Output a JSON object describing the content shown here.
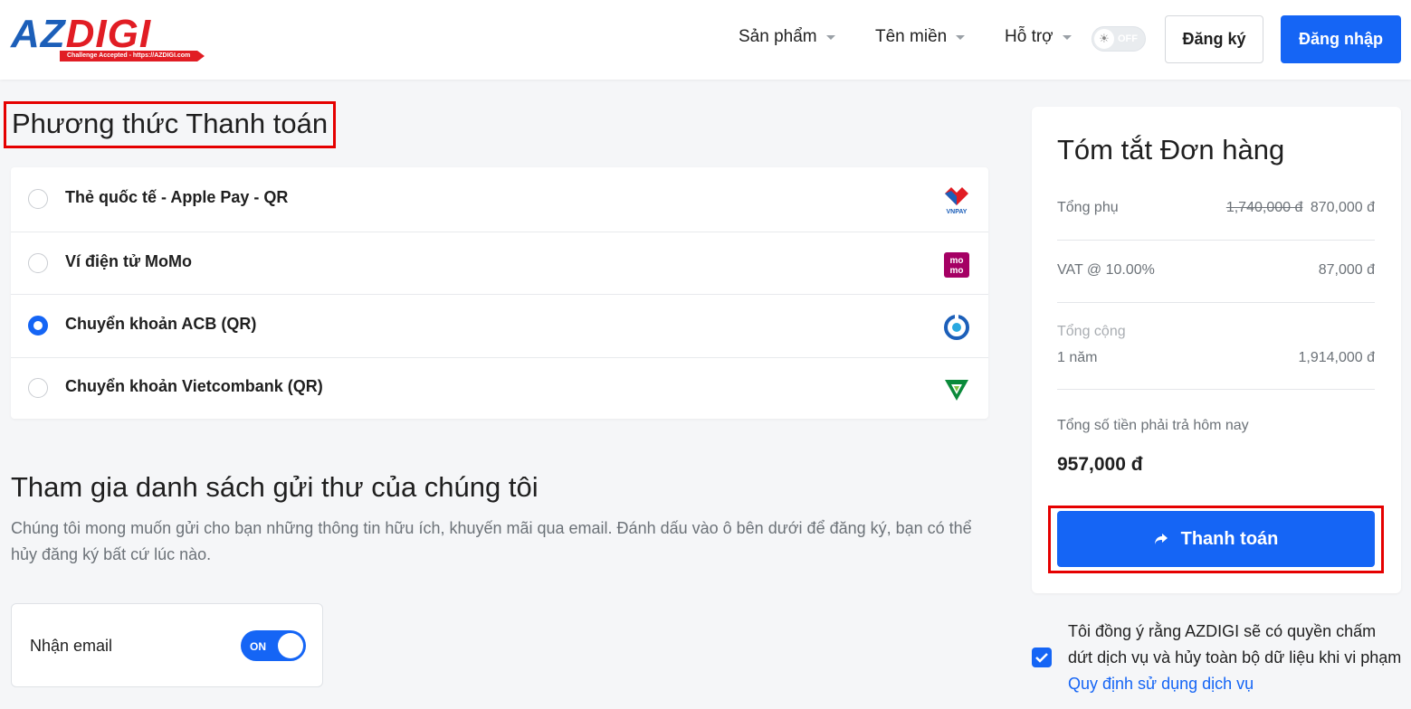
{
  "brand": {
    "name_part1": "AZ",
    "name_part2": "DIGI",
    "tagline": "Challenge Accepted - https://AZDIGI.com"
  },
  "nav": {
    "products": "Sản phẩm",
    "domains": "Tên miền",
    "support": "Hỗ trợ",
    "theme_toggle": "OFF",
    "register": "Đăng ký",
    "login": "Đăng nhập"
  },
  "payment": {
    "title": "Phương thức Thanh toán",
    "methods": [
      {
        "label": "Thẻ quốc tế - Apple Pay - QR",
        "icon": "vnpay-icon",
        "selected": false
      },
      {
        "label": "Ví điện tử MoMo",
        "icon": "momo-icon",
        "selected": false
      },
      {
        "label": "Chuyển khoản ACB (QR)",
        "icon": "acb-icon",
        "selected": true
      },
      {
        "label": "Chuyển khoản Vietcombank (QR)",
        "icon": "vietcombank-icon",
        "selected": false
      }
    ]
  },
  "mailing": {
    "title": "Tham gia danh sách gửi thư của chúng tôi",
    "description": "Chúng tôi mong muốn gửi cho bạn những thông tin hữu ích, khuyến mãi qua email. Đánh dấu vào ô bên dưới để đăng ký, bạn có thể hủy đăng ký bất cứ lúc nào.",
    "email_label": "Nhận email",
    "switch_text": "ON"
  },
  "summary": {
    "title": "Tóm tắt Đơn hàng",
    "subtotal_label": "Tổng phụ",
    "subtotal_old": "1,740,000 đ",
    "subtotal_new": "870,000 đ",
    "vat_label": "VAT @ 10.00%",
    "vat_value": "87,000 đ",
    "total_label": "Tổng cộng",
    "period_label": "1 năm",
    "period_value": "1,914,000 đ",
    "due_today_label": "Tổng số tiền phải trả hôm nay",
    "due_today_value": "957,000 đ",
    "checkout": "Thanh toán"
  },
  "agreement": {
    "text": "Tôi đồng ý rằng AZDIGI sẽ có quyền chấm dứt dịch vụ và hủy toàn bộ dữ liệu khi vi phạm",
    "link": "Quy định sử dụng dịch vụ",
    "checked": true
  },
  "colors": {
    "primary": "#1565f5",
    "highlight_border": "#e50000",
    "brand_red": "#e11d24",
    "brand_blue": "#1c5fb9"
  }
}
